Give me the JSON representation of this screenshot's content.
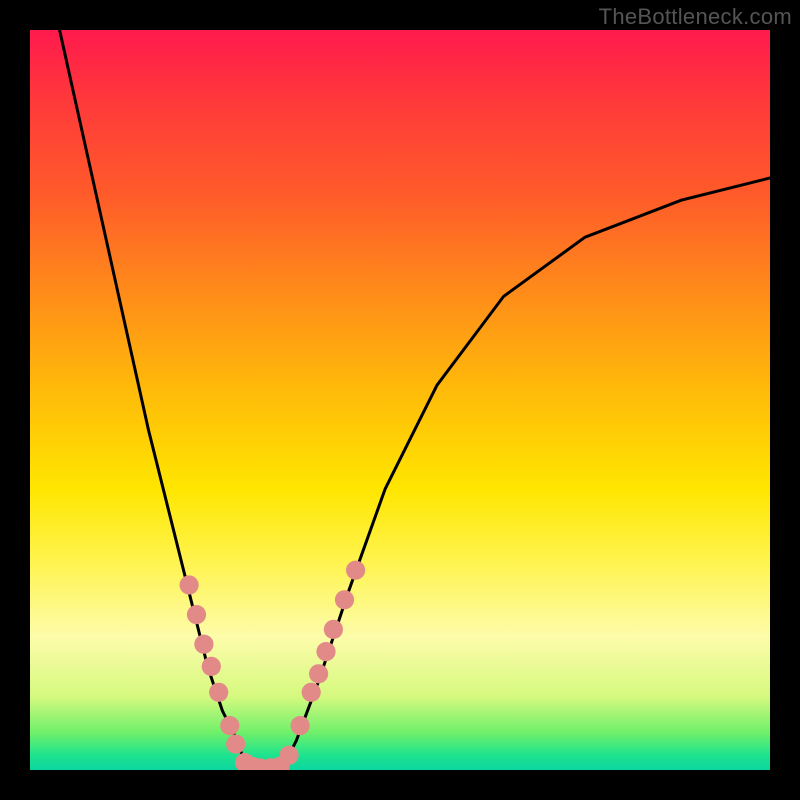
{
  "watermark": "TheBottleneck.com",
  "chart_data": {
    "type": "line",
    "title": "",
    "xlabel": "",
    "ylabel": "",
    "xlim": [
      0,
      100
    ],
    "ylim": [
      0,
      100
    ],
    "grid": false,
    "legend": false,
    "background_gradient": {
      "top": "#ff1a4d",
      "mid": "#ffe600",
      "bottom": "#0bd6a0"
    },
    "series": [
      {
        "name": "left-curve",
        "color": "#000000",
        "x": [
          4,
          8,
          12,
          16,
          19,
          22,
          24,
          26,
          28,
          29,
          30
        ],
        "y": [
          100,
          82,
          64,
          46,
          34,
          22,
          14,
          8,
          4,
          1,
          0
        ]
      },
      {
        "name": "right-curve",
        "color": "#000000",
        "x": [
          34,
          36,
          39,
          43,
          48,
          55,
          64,
          75,
          88,
          100
        ],
        "y": [
          0,
          4,
          12,
          24,
          38,
          52,
          64,
          72,
          77,
          80
        ]
      }
    ],
    "points": {
      "name": "markers",
      "color": "#e28a88",
      "radius_pct": 1.3,
      "coords": [
        [
          21.5,
          25
        ],
        [
          22.5,
          21
        ],
        [
          23.5,
          17
        ],
        [
          24.5,
          14
        ],
        [
          25.5,
          10.5
        ],
        [
          27.0,
          6.0
        ],
        [
          27.8,
          3.5
        ],
        [
          29.0,
          1.0
        ],
        [
          30.0,
          0.5
        ],
        [
          31.0,
          0.3
        ],
        [
          32.5,
          0.3
        ],
        [
          33.8,
          0.5
        ],
        [
          35.0,
          2.0
        ],
        [
          36.5,
          6.0
        ],
        [
          38.0,
          10.5
        ],
        [
          39.0,
          13.0
        ],
        [
          40.0,
          16.0
        ],
        [
          41.0,
          19.0
        ],
        [
          42.5,
          23.0
        ],
        [
          44.0,
          27.0
        ]
      ]
    }
  }
}
